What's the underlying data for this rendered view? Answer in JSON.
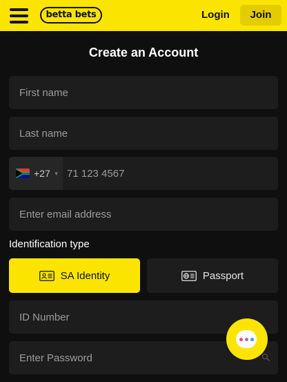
{
  "header": {
    "logo_text": "betta bets",
    "login_label": "Login",
    "join_label": "Join"
  },
  "form": {
    "title": "Create an Account",
    "first_name": {
      "value": "",
      "placeholder": "First name"
    },
    "last_name": {
      "value": "",
      "placeholder": "Last name"
    },
    "phone": {
      "country_flag": "south-africa-flag",
      "dial_code": "+27",
      "value": "",
      "placeholder": "71 123 4567"
    },
    "email": {
      "value": "",
      "placeholder": "Enter email address"
    },
    "identification": {
      "label": "Identification type",
      "options": [
        {
          "label": "SA Identity",
          "icon": "id-card-icon",
          "selected": true
        },
        {
          "label": "Passport",
          "icon": "passport-icon",
          "selected": false
        }
      ]
    },
    "id_number": {
      "value": "",
      "placeholder": "ID Number"
    },
    "password": {
      "value": "",
      "placeholder": "Enter Password"
    }
  },
  "chat": {
    "icon": "chat-icon"
  },
  "colors": {
    "brand_yellow": "#fbe500",
    "background": "#0f0f0f",
    "field_background": "#1d1d1d",
    "chat_dots": [
      "#e84a6c",
      "#9b6ad9",
      "#5a8df0"
    ]
  }
}
